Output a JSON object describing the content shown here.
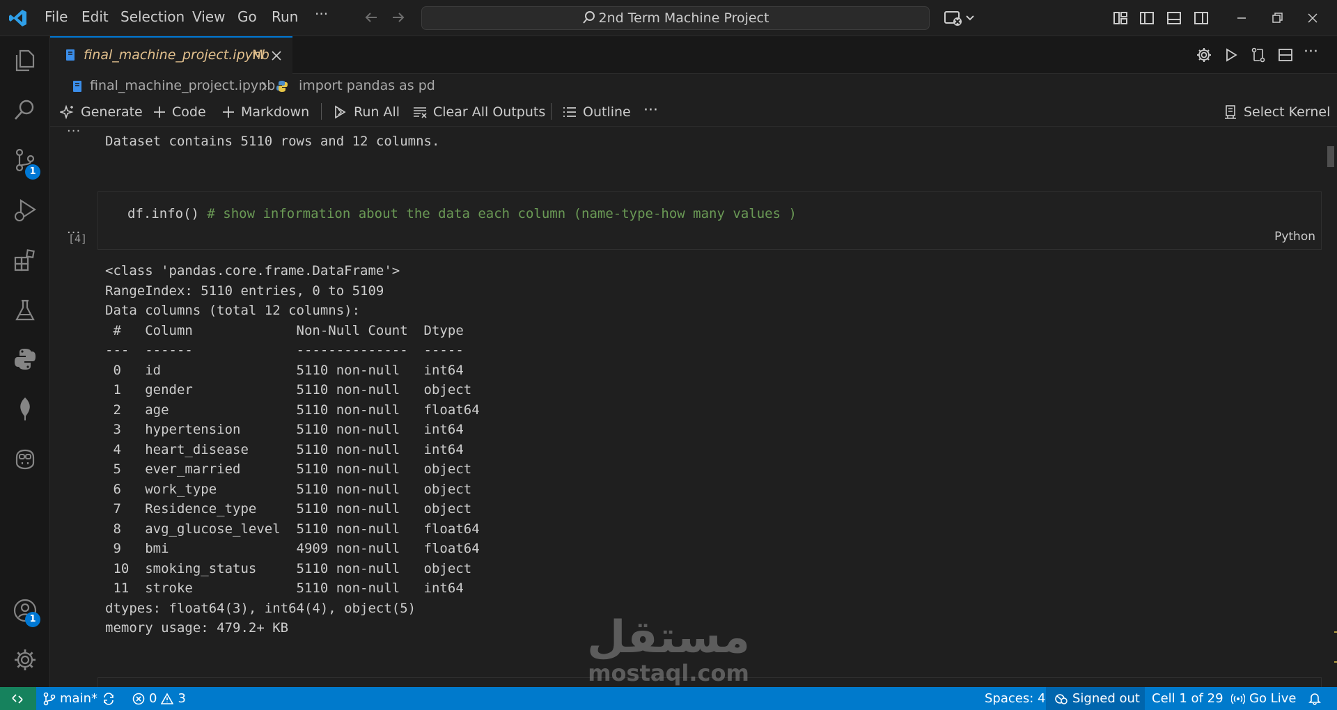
{
  "menu": [
    "File",
    "Edit",
    "Selection",
    "View",
    "Go",
    "Run"
  ],
  "search": {
    "text": "2nd Term Machine Project"
  },
  "activity_badges": {
    "source_control": "1",
    "accounts": "1"
  },
  "tab": {
    "title": "final_machine_project.ipynb",
    "status": "M"
  },
  "breadcrumb": {
    "file": "final_machine_project.ipynb",
    "symbol": "import pandas as pd"
  },
  "toolbar": {
    "generate": "Generate",
    "code": "Code",
    "markdown": "Markdown",
    "run_all": "Run All",
    "clear_outputs": "Clear All Outputs",
    "outline": "Outline",
    "kernel": "Select Kernel"
  },
  "output_top": "Dataset contains 5110 rows and 12 columns.",
  "code_cell": {
    "exec_count": "[4]",
    "code": "df.info()",
    "comment": "# show information about the data each column (name-type-how many values )",
    "language": "Python"
  },
  "info_output": [
    "<class 'pandas.core.frame.DataFrame'>",
    "RangeIndex: 5110 entries, 0 to 5109",
    "Data columns (total 12 columns):",
    " #   Column             Non-Null Count  Dtype  ",
    "---  ------             --------------  -----  ",
    " 0   id                 5110 non-null   int64  ",
    " 1   gender             5110 non-null   object ",
    " 2   age                5110 non-null   float64",
    " 3   hypertension       5110 non-null   int64  ",
    " 4   heart_disease      5110 non-null   int64  ",
    " 5   ever_married       5110 non-null   object ",
    " 6   work_type          5110 non-null   object ",
    " 7   Residence_type     5110 non-null   object ",
    " 8   avg_glucose_level  5110 non-null   float64",
    " 9   bmi                4909 non-null   float64",
    " 10  smoking_status     5110 non-null   object ",
    " 11  stroke             5110 non-null   int64  ",
    "dtypes: float64(3), int64(4), object(5)",
    "memory usage: 479.2+ KB"
  ],
  "status": {
    "branch": "main*",
    "errors": "0",
    "warnings": "3",
    "spaces": "Spaces: 4",
    "signed_out": "Signed out",
    "cell": "Cell 1 of 29",
    "go_live": "Go Live"
  },
  "watermark": {
    "arabic": "مستقل",
    "latin": "mostaql.com"
  },
  "colors": {
    "accent": "#0078d4",
    "statusbar": "#007acc",
    "remote": "#16825d",
    "modified": "#e2c08d",
    "comment": "#6a9955"
  }
}
